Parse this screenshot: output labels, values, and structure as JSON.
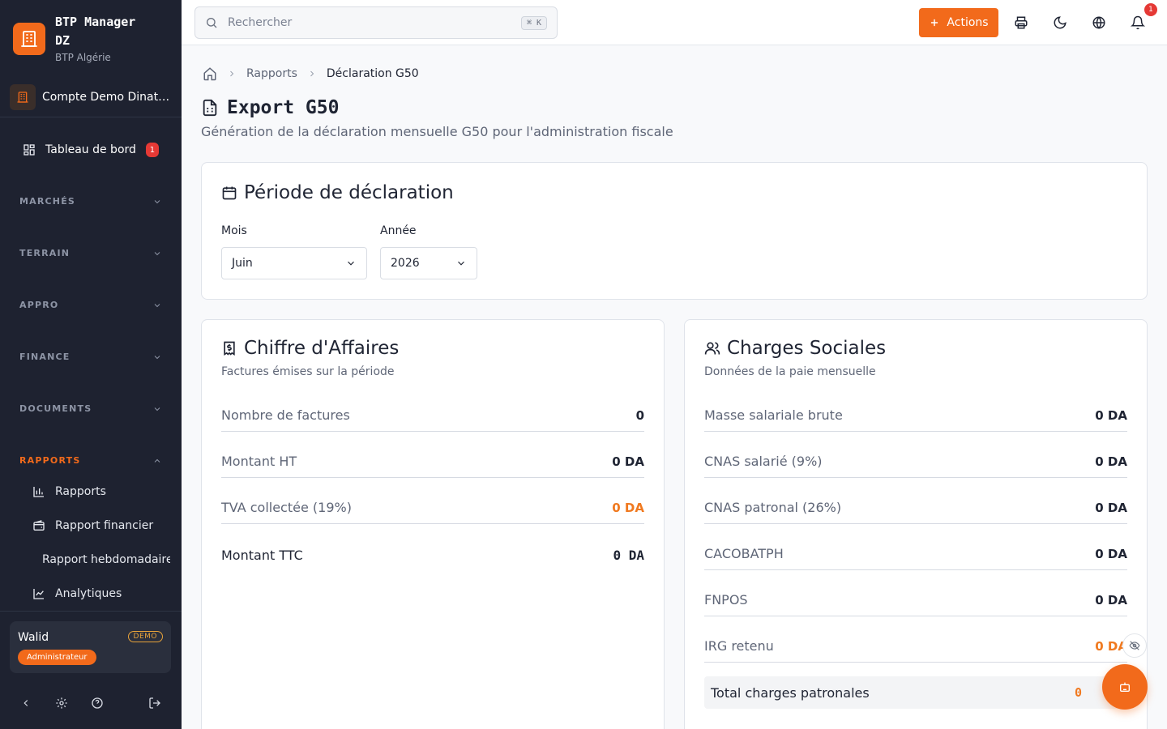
{
  "brand": {
    "name": "BTP Manager DZ",
    "subtitle": "BTP Algérie"
  },
  "account": {
    "name": "Compte Demo Dinatech"
  },
  "sidebar": {
    "dashboard": {
      "label": "Tableau de bord",
      "badge": "1"
    },
    "sections": [
      {
        "label": "MARCHÉS"
      },
      {
        "label": "TERRAIN"
      },
      {
        "label": "APPRO"
      },
      {
        "label": "FINANCE"
      },
      {
        "label": "DOCUMENTS"
      },
      {
        "label": "RAPPORTS"
      }
    ],
    "report_items": [
      {
        "label": "Rapports",
        "icon": "bar-chart-icon"
      },
      {
        "label": "Rapport financier",
        "icon": "wallet-icon"
      },
      {
        "label": "Rapport hebdomadaire",
        "icon": "calendar-icon"
      },
      {
        "label": "Analytiques",
        "icon": "line-chart-icon"
      }
    ]
  },
  "user": {
    "name": "Walid",
    "tag": "DEMO",
    "role": "Administrateur"
  },
  "topbar": {
    "search_placeholder": "Rechercher",
    "shortcut": "⌘ K",
    "actions_label": "Actions",
    "notification_count": "1"
  },
  "breadcrumb": {
    "parent": "Rapports",
    "current": "Déclaration G50"
  },
  "page": {
    "title": "Export G50",
    "subtitle": "Génération de la déclaration mensuelle G50 pour l'administration fiscale"
  },
  "period": {
    "title": "Période de déclaration",
    "month_label": "Mois",
    "month_value": "Juin",
    "year_label": "Année",
    "year_value": "2026"
  },
  "revenue": {
    "title": "Chiffre d'Affaires",
    "desc": "Factures émises sur la période",
    "rows": [
      {
        "label": "Nombre de factures",
        "value": "0"
      },
      {
        "label": "Montant HT",
        "value": "0 DA"
      },
      {
        "label": "TVA collectée (19%)",
        "value": "0 DA"
      }
    ],
    "total": {
      "label": "Montant TTC",
      "value": "0 DA"
    }
  },
  "social": {
    "title": "Charges Sociales",
    "desc": "Données de la paie mensuelle",
    "rows": [
      {
        "label": "Masse salariale brute",
        "value": "0 DA"
      },
      {
        "label": "CNAS salarié (9%)",
        "value": "0 DA"
      },
      {
        "label": "CNAS patronal (26%)",
        "value": "0 DA"
      },
      {
        "label": "CACOBATPH",
        "value": "0 DA"
      },
      {
        "label": "FNPOS",
        "value": "0 DA"
      },
      {
        "label": "IRG retenu",
        "value": "0 DA"
      }
    ],
    "total": {
      "label": "Total charges patronales",
      "value": "0"
    }
  },
  "colors": {
    "accent": "#f26a1b",
    "sidebar_bg": "#1e2230",
    "danger": "#e53935"
  }
}
